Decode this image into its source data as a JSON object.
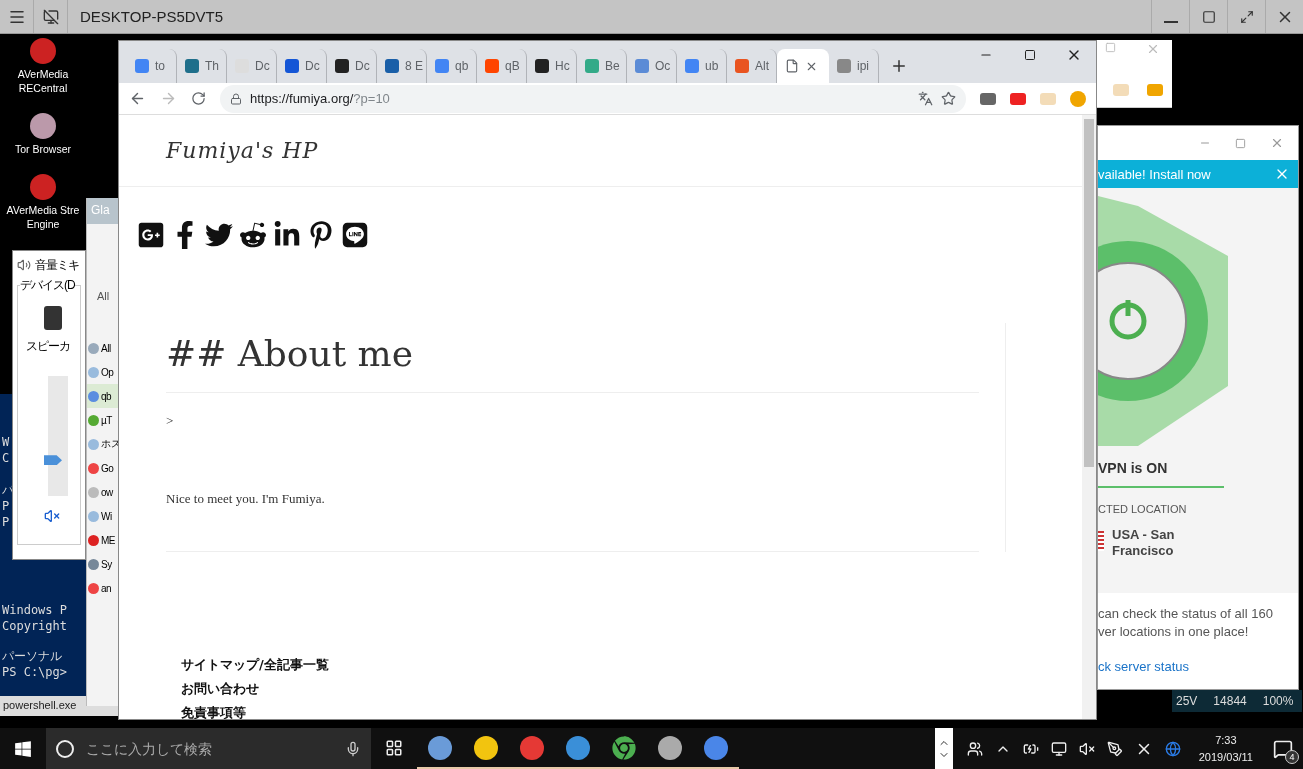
{
  "remote_window": {
    "title": "DESKTOP-PS5DVT5"
  },
  "desktop_icons": [
    {
      "lines": [
        "AVerMedia",
        "RECentral"
      ]
    },
    {
      "lines": [
        "Tor Browser"
      ]
    },
    {
      "lines": [
        "AVerMedia Stre",
        "Engine"
      ]
    }
  ],
  "console": {
    "upper_lines": [
      "W",
      "C"
    ],
    "middle_lines": [
      "パ",
      "P",
      "P"
    ],
    "lower_lines": [
      "Windows P",
      "Copyright",
      "パーソナル",
      "PS C:\\pg>"
    ],
    "status": "powershell.exe"
  },
  "volume_mixer": {
    "title": "音量ミキ",
    "group": "デバイス(D",
    "device": "スピーカ",
    "level": 0.28,
    "muted": true
  },
  "app_list": {
    "tab": "Gla",
    "filter": "All",
    "items": [
      {
        "label": "All",
        "selected": false
      },
      {
        "label": "Op",
        "selected": false
      },
      {
        "label": "qb",
        "selected": true
      },
      {
        "label": "µT",
        "selected": false
      },
      {
        "label": "ホス",
        "selected": false
      },
      {
        "label": "Go",
        "selected": false
      },
      {
        "label": "ow",
        "selected": false
      },
      {
        "label": "Wi",
        "selected": false
      },
      {
        "label": "ME",
        "selected": false
      },
      {
        "label": "Sy",
        "selected": false
      },
      {
        "label": "an",
        "selected": false
      }
    ]
  },
  "browser": {
    "tabs": [
      {
        "label": "to",
        "selected": false
      },
      {
        "label": "Th",
        "selected": false
      },
      {
        "label": "Dc",
        "selected": false
      },
      {
        "label": "Dc",
        "selected": false
      },
      {
        "label": "Dc",
        "selected": false
      },
      {
        "label": "8 E",
        "selected": false
      },
      {
        "label": "qb",
        "selected": false
      },
      {
        "label": "qB",
        "selected": false
      },
      {
        "label": "Hc",
        "selected": false
      },
      {
        "label": "Be",
        "selected": false
      },
      {
        "label": "Oc",
        "selected": false
      },
      {
        "label": "ub",
        "selected": false
      },
      {
        "label": "Alt",
        "selected": false
      },
      {
        "selected": true
      },
      {
        "label": "ipi",
        "selected": false
      }
    ],
    "url_host": "https://fumiya.org/",
    "url_path": "?p=10",
    "page": {
      "site_title": "Fumiya's HP",
      "heading": "## About me",
      "quote_mark": ">",
      "body": "Nice to meet you. I'm Fumiya.",
      "footer_links": [
        "サイトマップ/全記事一覧",
        "お問い合わせ",
        "免責事項等"
      ]
    }
  },
  "vpn": {
    "banner": "vailable! Install now",
    "status": "VPN is ON",
    "location_label": "CTED LOCATION",
    "location": "USA - San Francisco",
    "message_lines": [
      "can check the status of all 160",
      "ver locations in one place!"
    ],
    "link": "ck server status"
  },
  "status_strip": [
    "25V",
    "14844",
    "100%"
  ],
  "taskbar": {
    "search_placeholder": "ここに入力して検索",
    "time": "7:33",
    "date": "2019/03/11",
    "notifications": "4"
  }
}
